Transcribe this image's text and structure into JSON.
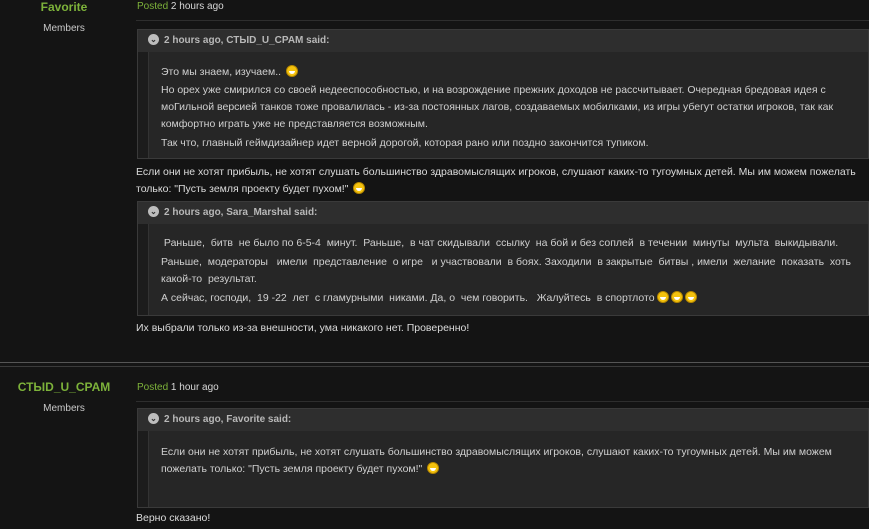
{
  "posts": [
    {
      "author": "Favorite",
      "group": "Members",
      "posted_label": "Posted",
      "time": "2 hours ago",
      "quote1": {
        "header": "2 hours ago, СТЫD_U_CPAM said:",
        "lines": [
          "Это мы знаем, изучаем..",
          "Но орех уже смирился со своей недееспособностью, и на возрождение прежних доходов не рассчитывает. Очередная бредовая идея с",
          "моГильной версией танков тоже провалилась - из-за постоянных лагов, создаваемых мобилками, из игры убегут остатки игроков, так как",
          "комфортно играть уже не представляется возможным.",
          "Так что, главный геймдизайнер идет верной дорогой, которая рано или поздно закончится тупиком."
        ]
      },
      "text1": [
        "Если они не хотят прибыль, не хотят слушать большинство здравомыслящих игроков, слушают каких-то тугоумных детей. Мы им можем пожелать",
        "только: \"Пусть земля проекту будет пухом!\""
      ],
      "quote2": {
        "header": "2 hours ago, Sara_Marshal said:",
        "lines": [
          " Раньше,  битв  не было по 6-5-4  минут.  Раньше,  в чат скидывали  ссылку  на бой и без соплей  в течении  минуты  мульта  выкидывали.",
          "Раньше,  модераторы   имели  представление  о игре   и участвовали  в боях. Заходили  в закрытые  битвы , имели  желание  показать  хоть",
          "какой-то  результат.",
          "А сейчас, господи,  19 -22  лет  с гламурными  никами. Да, о  чем говорить.   Жалуйтесь  в спортлото"
        ]
      },
      "text2": "Их выбрали только из-за внешности, ума никакого нет. Проверенно!"
    },
    {
      "author": "СТЫD_U_CPAM",
      "group": "Members",
      "posted_label": "Posted",
      "time": "1 hour ago",
      "quote1": {
        "header": "2 hours ago, Favorite said:",
        "lines": [
          "Если они не хотят прибыль, не хотят слушать большинство здравомыслящих игроков, слушают каких-то тугоумных детей. Мы им можем",
          "пожелать только: \"Пусть земля проекту будет пухом!\""
        ]
      },
      "text1": "Верно сказано!"
    }
  ],
  "icons": {
    "quote_toggle": "chevron-down-icon",
    "smiley": "grin-emoji-icon"
  },
  "colors": {
    "author": "#7db23a",
    "posted": "#7db23a",
    "background": "#141414",
    "quote_header": "#2e2e2e"
  }
}
